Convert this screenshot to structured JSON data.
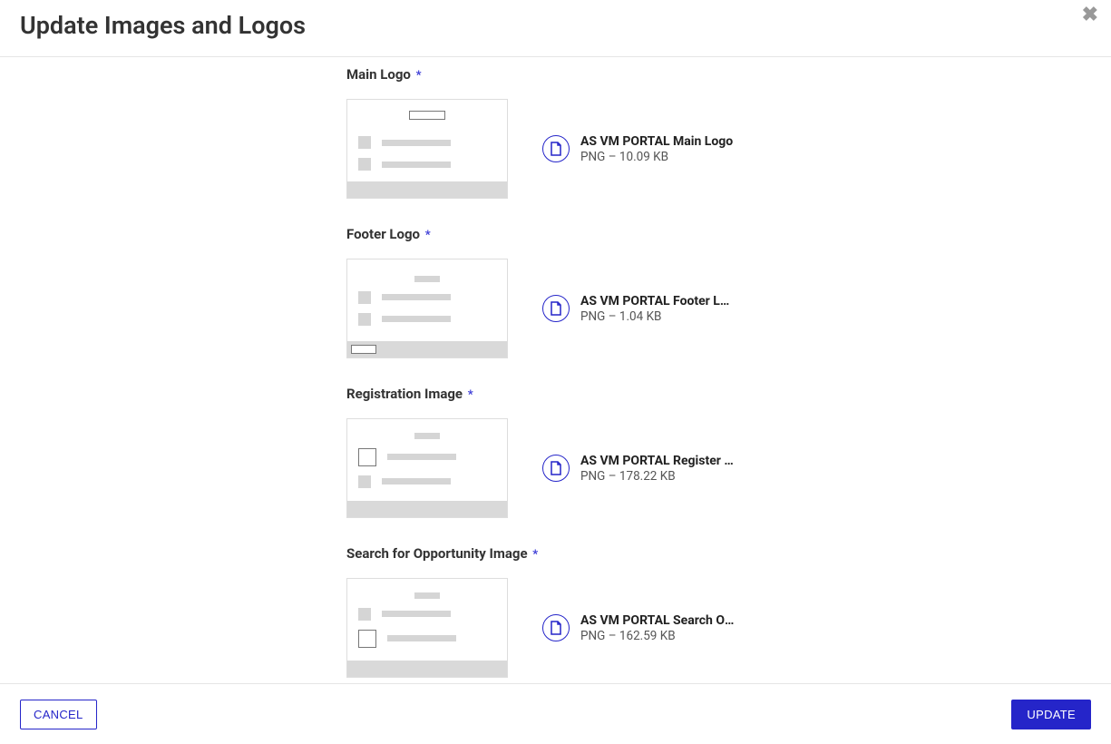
{
  "modal": {
    "title": "Update Images and Logos",
    "close_label": "✖"
  },
  "sections": {
    "main_logo": {
      "label": "Main Logo",
      "file_name": "AS VM PORTAL Main Logo",
      "file_meta": "PNG – 10.09 KB"
    },
    "footer_logo": {
      "label": "Footer Logo",
      "file_name": "AS VM PORTAL Footer Logo",
      "file_meta": "PNG – 1.04 KB"
    },
    "registration_image": {
      "label": "Registration Image",
      "file_name": "AS VM PORTAL Register Volunteer Image",
      "file_meta": "PNG – 178.22 KB"
    },
    "search_opportunity": {
      "label": "Search for Opportunity Image",
      "file_name": "AS VM PORTAL Search Opportunity Image",
      "file_meta": "PNG – 162.59 KB"
    }
  },
  "buttons": {
    "cancel": "CANCEL",
    "update": "UPDATE"
  },
  "required_marker": "*"
}
